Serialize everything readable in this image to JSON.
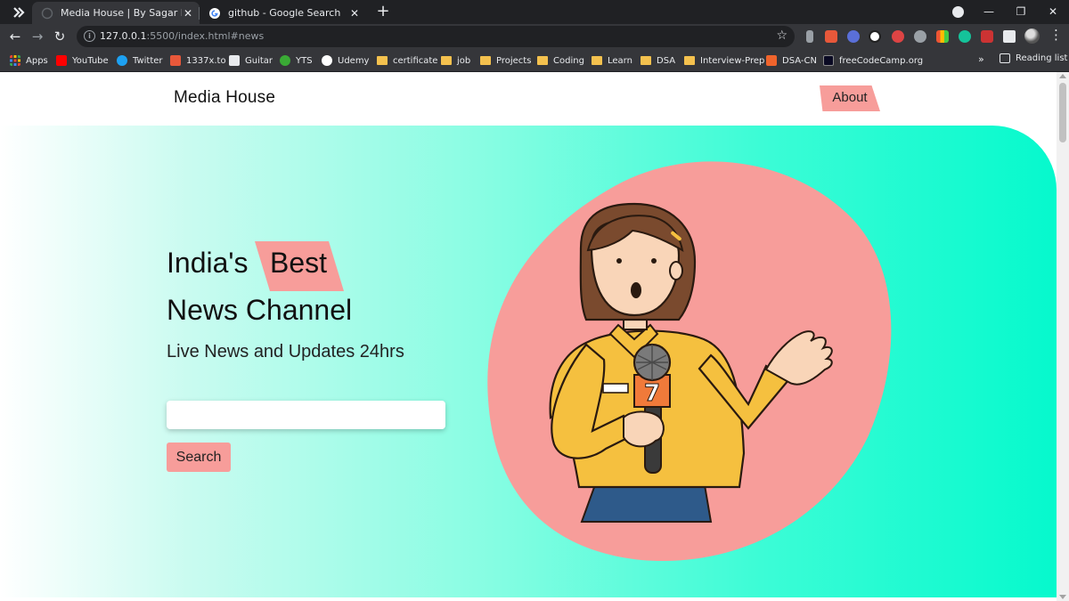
{
  "browser": {
    "tabs": [
      {
        "title": "Media House | By Sagar Paul",
        "active": true,
        "favicon": "globe-icon"
      },
      {
        "title": "github - Google Search",
        "active": false,
        "favicon": "google-icon"
      }
    ],
    "new_tab_label": "+",
    "window_controls": {
      "minimize": "—",
      "restore": "❐",
      "close": "✕"
    },
    "url_host": "127.0.0.1",
    "url_rest": ":5500/index.html#news",
    "bookmarks": [
      {
        "label": "Apps",
        "icon": "apps-grid-icon",
        "color": "#ea4335"
      },
      {
        "label": "YouTube",
        "icon": "youtube-icon",
        "color": "#ff0000"
      },
      {
        "label": "Twitter",
        "icon": "twitter-icon",
        "color": "#1da1f2"
      },
      {
        "label": "1337x.to",
        "icon": "1337x-icon",
        "color": "#e8583a"
      },
      {
        "label": "Guitar",
        "icon": "guitar-icon",
        "color": "#e8eaed"
      },
      {
        "label": "YTS",
        "icon": "yts-icon",
        "color": "#3aaa35"
      },
      {
        "label": "Udemy",
        "icon": "udemy-icon",
        "color": "#ffffff"
      },
      {
        "label": "certificate",
        "icon": "folder-icon",
        "color": "#f4c14e"
      },
      {
        "label": "job",
        "icon": "folder-icon",
        "color": "#f4c14e"
      },
      {
        "label": "Projects",
        "icon": "folder-icon",
        "color": "#f4c14e"
      },
      {
        "label": "Coding",
        "icon": "folder-icon",
        "color": "#f4c14e"
      },
      {
        "label": "Learn",
        "icon": "folder-icon",
        "color": "#f4c14e"
      },
      {
        "label": "DSA",
        "icon": "folder-icon",
        "color": "#f4c14e"
      },
      {
        "label": "Interview-Prep",
        "icon": "folder-icon",
        "color": "#f4c14e"
      },
      {
        "label": "DSA-CN",
        "icon": "codingninjas-icon",
        "color": "#f0642c"
      },
      {
        "label": "freeCodeCamp.org",
        "icon": "freecodecamp-icon",
        "color": "#0a0a23"
      }
    ],
    "bookmarks_more": "»",
    "reading_list": "Reading list"
  },
  "page": {
    "brand": "Media House",
    "nav_about": "About",
    "headline_prefix": "India's",
    "headline_highlight": "Best",
    "headline_line2": "News Channel",
    "subtitle": "Live News and Updates 24hrs",
    "search_placeholder": "",
    "search_button": "Search",
    "illustration": "news-reporter-illustration",
    "mic_number": "7"
  },
  "colors": {
    "accent_pink": "#f79d9a",
    "gradient_end": "#06f9cd",
    "chrome_dark": "#202124",
    "chrome_toolbar": "#35363a"
  }
}
